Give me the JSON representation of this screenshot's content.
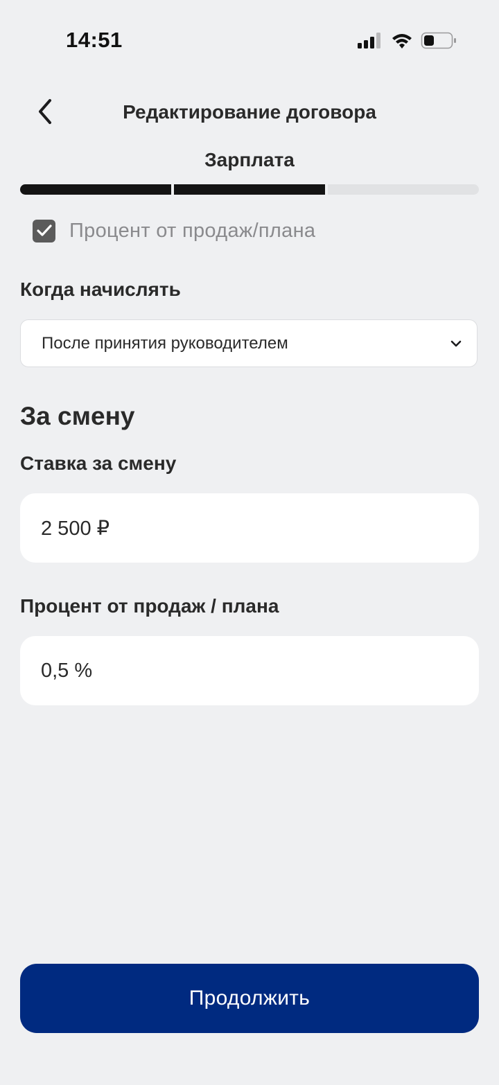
{
  "status_bar": {
    "time": "14:51"
  },
  "header": {
    "title": "Редактирование договора",
    "back_icon": "chevron-left-icon"
  },
  "step": {
    "title": "Зарплата",
    "progress": {
      "total_steps": 3,
      "completed_steps": 2
    }
  },
  "percent_option": {
    "label": "Процент от продаж/плана",
    "checked": true
  },
  "accrual": {
    "label": "Когда начислять",
    "selected_value": "После принятия руководителем"
  },
  "shift_section": {
    "heading": "За смену",
    "rate": {
      "label": "Ставка за смену",
      "value": "2 500 ₽"
    },
    "percent": {
      "label": "Процент от продаж / плана",
      "value": "0,5 %"
    }
  },
  "footer": {
    "continue_label": "Продолжить"
  },
  "colors": {
    "background": "#eff0f2",
    "primary": "#002a80",
    "progress_done": "#141414",
    "progress_todo": "#e1e2e4",
    "checkbox": "#5b5b5b"
  }
}
